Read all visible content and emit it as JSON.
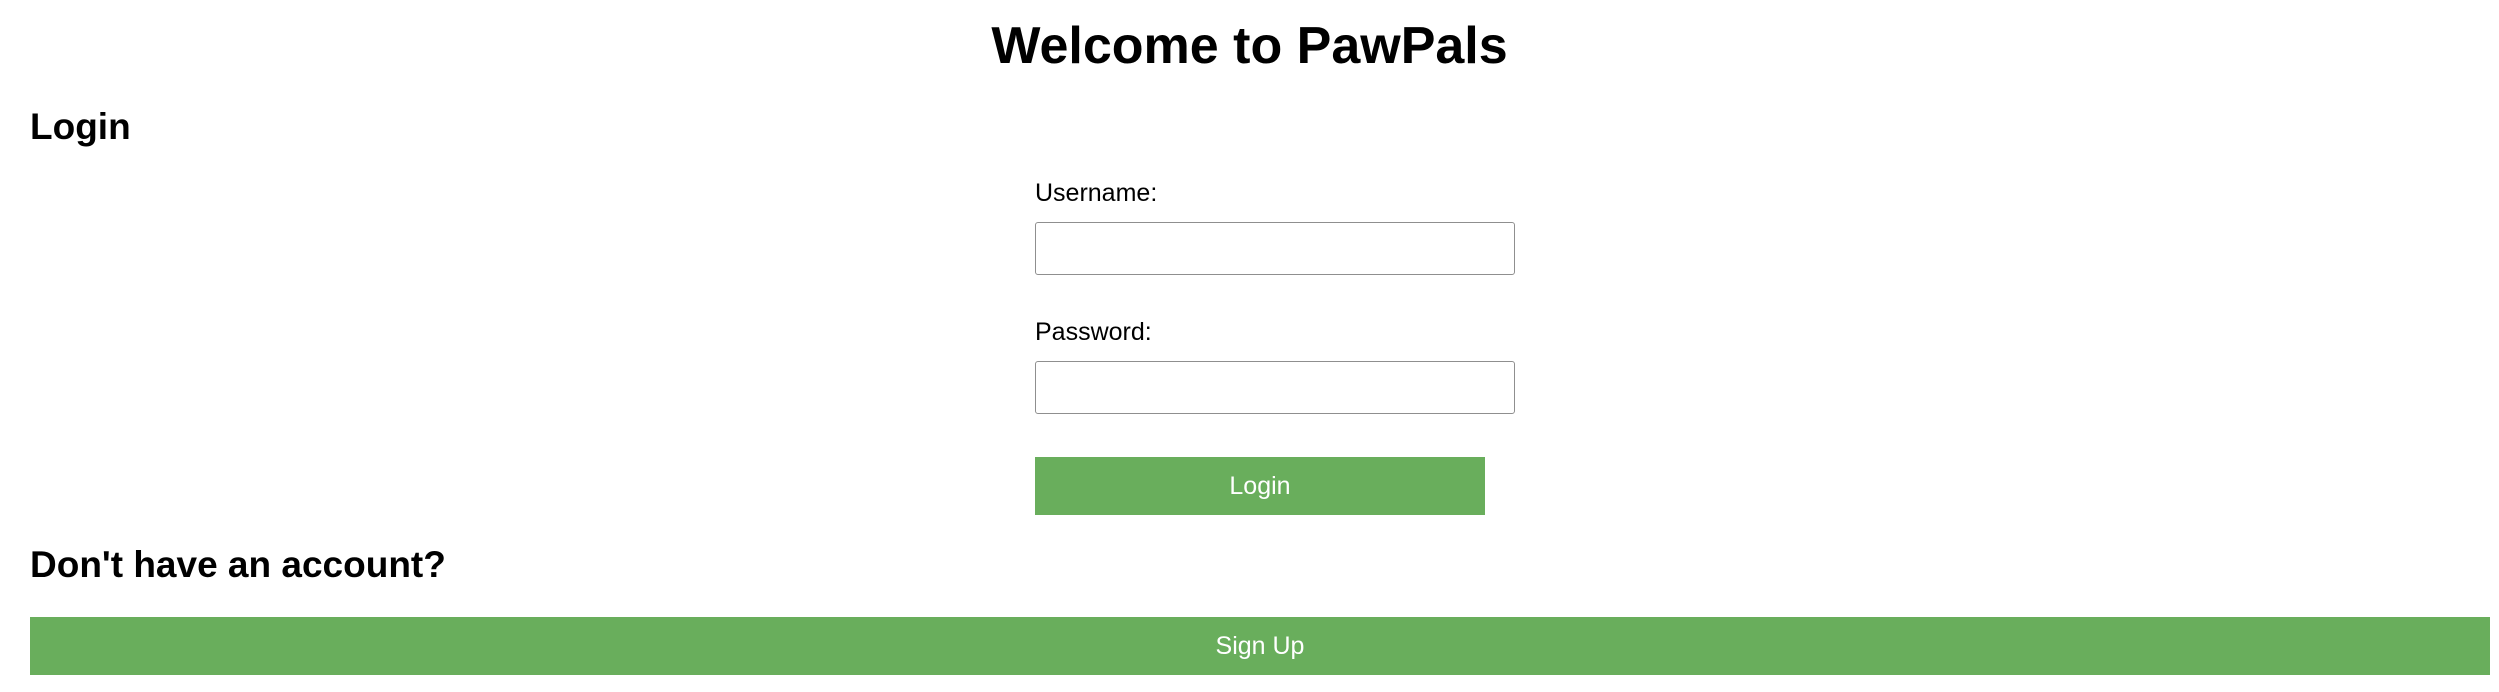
{
  "header": {
    "title": "Welcome to PawPals"
  },
  "login": {
    "heading": "Login",
    "username_label": "Username:",
    "username_value": "",
    "password_label": "Password:",
    "password_value": "",
    "submit_label": "Login"
  },
  "signup": {
    "heading": "Don't have an account?",
    "button_label": "Sign Up"
  },
  "colors": {
    "button_background": "#69ae5c",
    "button_text": "#ffffff",
    "input_border": "#8f8f8f"
  }
}
